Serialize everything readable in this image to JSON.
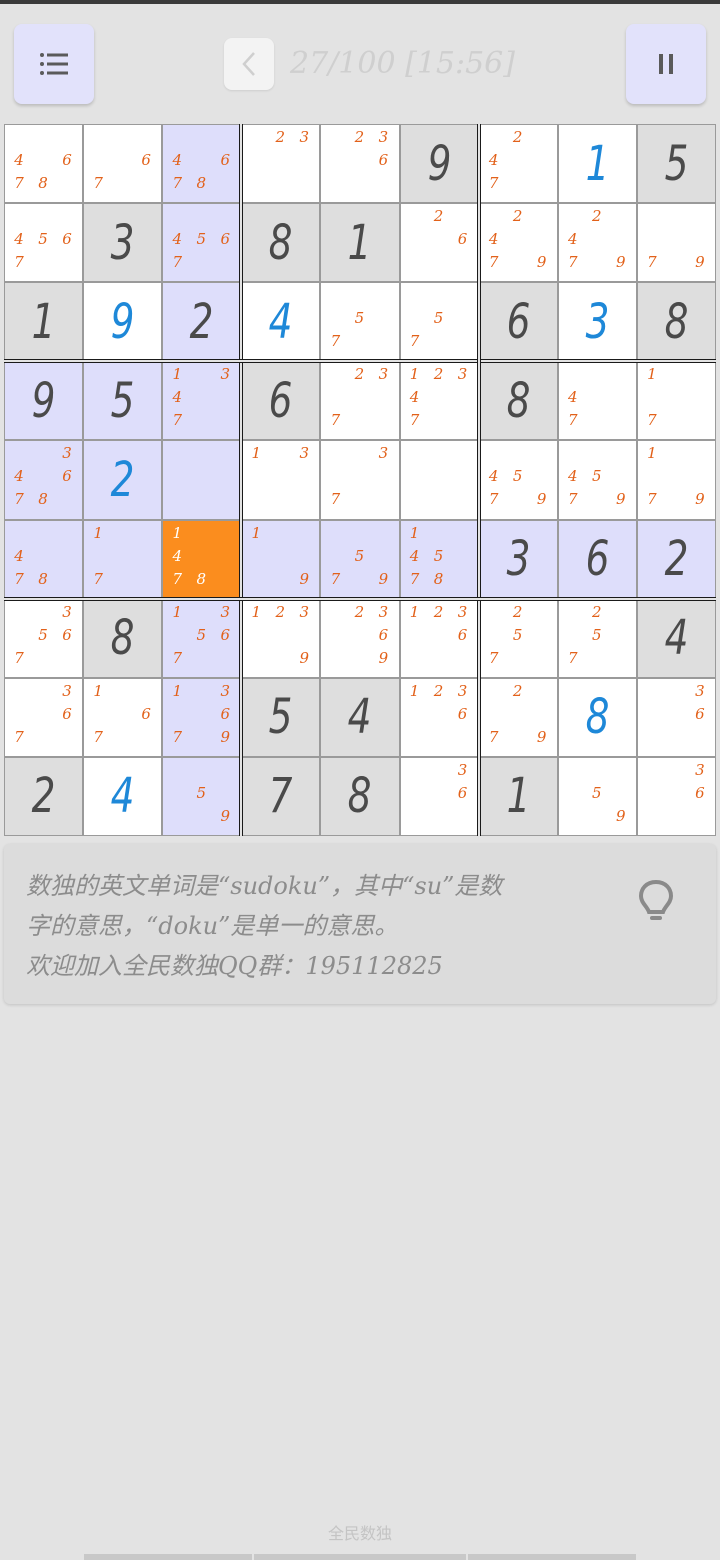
{
  "header": {
    "menu_icon": "list-icon",
    "back_icon": "chevron-left-icon",
    "progress_text": "27/100 [15:56]",
    "pause_icon": "pause-icon"
  },
  "board": {
    "selected_cell": [
      5,
      2
    ],
    "rows": [
      [
        {
          "c": [
            4,
            6,
            7,
            8
          ]
        },
        {
          "c": [
            6,
            7
          ]
        },
        {
          "c": [
            4,
            6,
            7,
            8
          ]
        },
        {
          "c": [
            2,
            3
          ]
        },
        {
          "c": [
            2,
            3,
            6
          ]
        },
        {
          "v": 9
        },
        {
          "c": [
            2,
            4,
            7
          ]
        },
        {
          "v": 1,
          "u": true
        },
        {
          "v": 5
        }
      ],
      [
        {
          "c": [
            4,
            5,
            6,
            7
          ]
        },
        {
          "v": 3
        },
        {
          "c": [
            4,
            5,
            6,
            7
          ]
        },
        {
          "v": 8
        },
        {
          "v": 1
        },
        {
          "c": [
            2,
            6
          ]
        },
        {
          "c": [
            2,
            4,
            7,
            9
          ]
        },
        {
          "c": [
            2,
            4,
            7,
            9
          ]
        },
        {
          "c": [
            7,
            9
          ]
        }
      ],
      [
        {
          "v": 1
        },
        {
          "v": 9,
          "u": true
        },
        {
          "v": 2
        },
        {
          "v": 4,
          "u": true
        },
        {
          "c": [
            5,
            7
          ]
        },
        {
          "c": [
            5,
            7
          ]
        },
        {
          "v": 6
        },
        {
          "v": 3,
          "u": true
        },
        {
          "v": 8
        }
      ],
      [
        {
          "v": 9
        },
        {
          "v": 5
        },
        {
          "c": [
            1,
            3,
            4,
            7
          ]
        },
        {
          "v": 6
        },
        {
          "c": [
            2,
            3,
            7
          ]
        },
        {
          "c": [
            1,
            2,
            3,
            4,
            7
          ]
        },
        {
          "v": 8
        },
        {
          "c": [
            4,
            7
          ]
        },
        {
          "c": [
            1,
            7
          ]
        }
      ],
      [
        {
          "c": [
            3,
            4,
            6,
            7,
            8
          ]
        },
        {
          "v": 2,
          "u": true
        },
        {
          "c": []
        },
        {
          "c": [
            1,
            3
          ]
        },
        {
          "c": [
            3,
            7
          ]
        },
        {
          "c": []
        },
        {
          "c": [
            4,
            5,
            7,
            9
          ]
        },
        {
          "c": [
            4,
            5,
            7,
            9
          ]
        },
        {
          "c": [
            1,
            7,
            9
          ]
        }
      ],
      [
        {
          "c": [
            4,
            7,
            8
          ]
        },
        {
          "c": [
            1,
            7
          ]
        },
        {
          "c": [
            1,
            4,
            7,
            8
          ]
        },
        {
          "c": [
            1,
            9
          ]
        },
        {
          "c": [
            5,
            7,
            9
          ]
        },
        {
          "c": [
            1,
            4,
            5,
            7,
            8
          ]
        },
        {
          "v": 3
        },
        {
          "v": 6
        },
        {
          "v": 2
        }
      ],
      [
        {
          "c": [
            3,
            5,
            6,
            7
          ]
        },
        {
          "v": 8
        },
        {
          "c": [
            1,
            3,
            5,
            6,
            7
          ]
        },
        {
          "c": [
            1,
            2,
            3,
            9
          ]
        },
        {
          "c": [
            2,
            3,
            6,
            9
          ]
        },
        {
          "c": [
            1,
            2,
            3,
            6
          ]
        },
        {
          "c": [
            2,
            5,
            7
          ]
        },
        {
          "c": [
            2,
            5,
            7
          ]
        },
        {
          "v": 4
        }
      ],
      [
        {
          "c": [
            3,
            6,
            7
          ]
        },
        {
          "c": [
            1,
            6,
            7
          ]
        },
        {
          "c": [
            1,
            3,
            6,
            7,
            9
          ]
        },
        {
          "v": 5
        },
        {
          "v": 4
        },
        {
          "c": [
            1,
            2,
            3,
            6
          ]
        },
        {
          "c": [
            2,
            7,
            9
          ]
        },
        {
          "v": 8,
          "u": true
        },
        {
          "c": [
            3,
            6
          ]
        }
      ],
      [
        {
          "v": 2
        },
        {
          "v": 4,
          "u": true
        },
        {
          "c": [
            5,
            9
          ]
        },
        {
          "v": 7
        },
        {
          "v": 8
        },
        {
          "c": [
            3,
            6
          ]
        },
        {
          "v": 1
        },
        {
          "c": [
            5,
            9
          ]
        },
        {
          "c": [
            3,
            6
          ]
        }
      ]
    ]
  },
  "tip": {
    "line1": "数独的英文单词是“sudoku”，其中“su”是数",
    "line2": "字的意思，“doku”是单一的意思。",
    "line3": "欢迎加入全民数独QQ群：195112825",
    "hint_icon": "lightbulb-icon"
  },
  "footer": {
    "app_name": "全民数独"
  }
}
